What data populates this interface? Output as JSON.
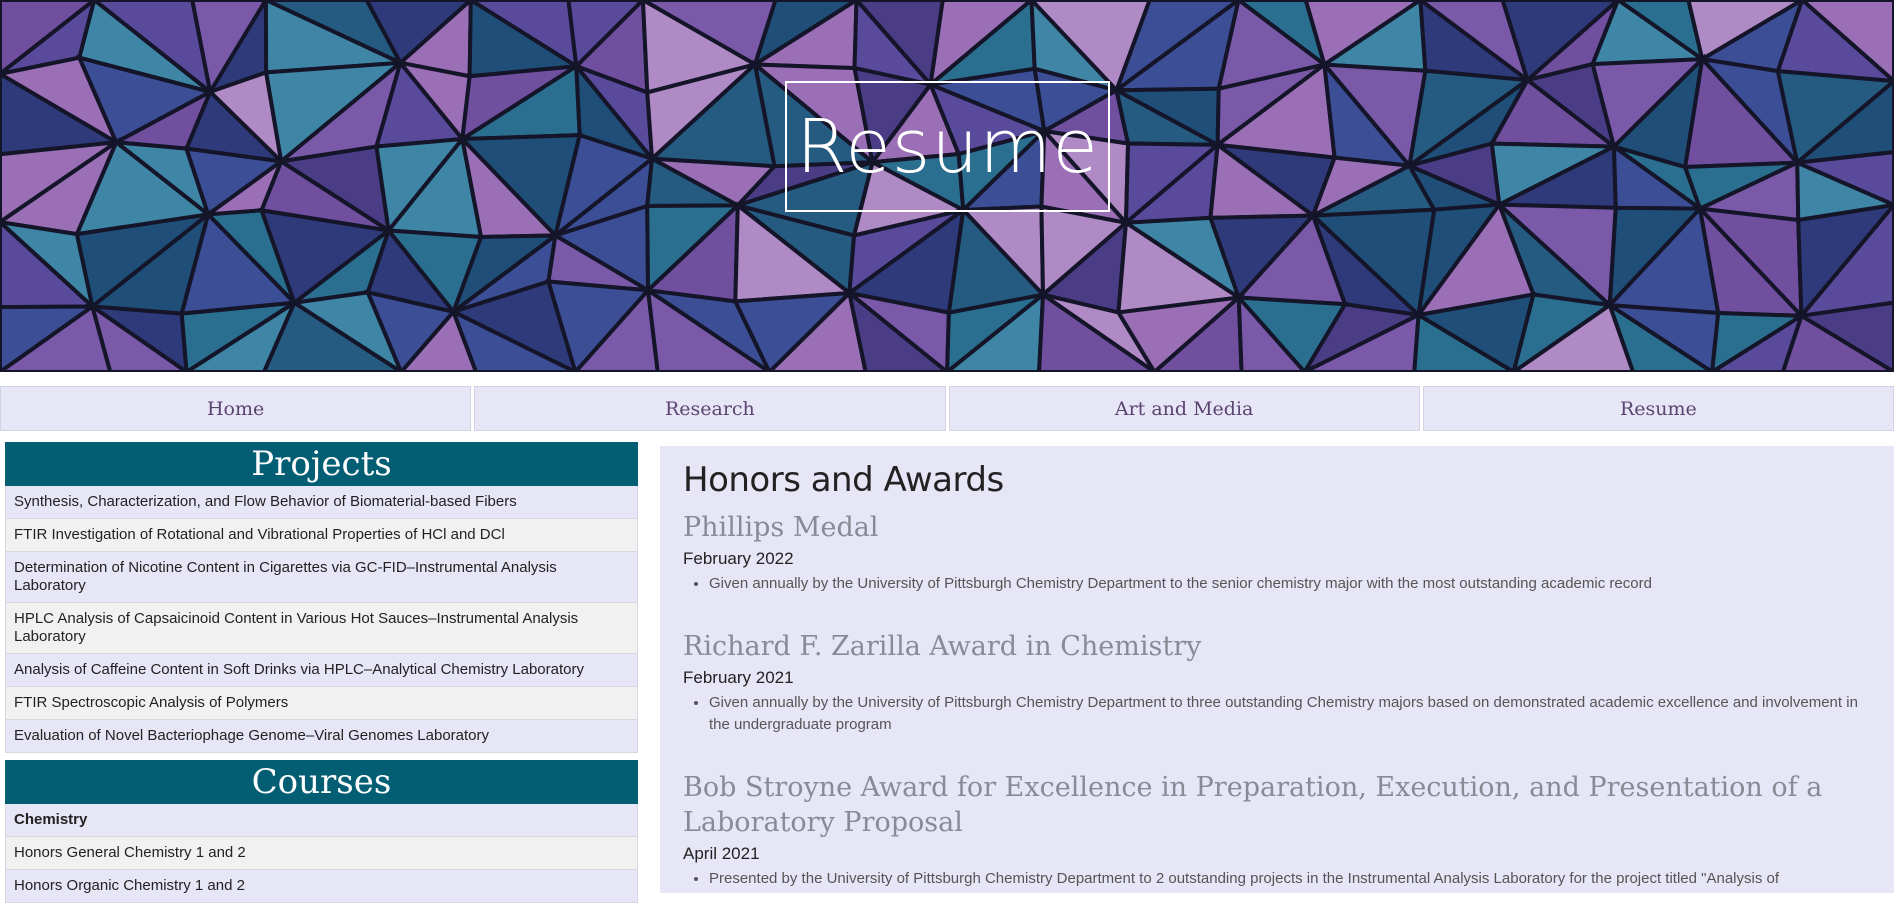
{
  "hero": {
    "title": "Resume"
  },
  "nav": {
    "items": [
      {
        "label": "Home"
      },
      {
        "label": "Research"
      },
      {
        "label": "Art and Media"
      },
      {
        "label": "Resume"
      }
    ]
  },
  "sidebar": {
    "projects": {
      "heading": "Projects",
      "items": [
        "Synthesis, Characterization, and Flow Behavior of Biomaterial-based Fibers",
        "FTIR Investigation of Rotational and Vibrational Properties of HCl and DCl",
        "Determination of Nicotine Content in Cigarettes via GC-FID–Instrumental Analysis Laboratory",
        "HPLC Analysis of Capsaicinoid Content in Various Hot Sauces–Instrumental Analysis Laboratory",
        "Analysis of Caffeine Content in Soft Drinks via HPLC–Analytical Chemistry Laboratory",
        "FTIR Spectroscopic Analysis of Polymers",
        "Evaluation of Novel Bacteriophage Genome–Viral Genomes Laboratory"
      ]
    },
    "courses": {
      "heading": "Courses",
      "subheading": "Chemistry",
      "items": [
        "Honors General Chemistry 1 and 2",
        "Honors Organic Chemistry 1 and 2"
      ]
    }
  },
  "main": {
    "heading": "Honors and Awards",
    "awards": [
      {
        "name": "Phillips Medal",
        "date": "February 2022",
        "desc": "Given annually by the University of Pittsburgh Chemistry Department to the senior chemistry major with the most outstanding academic record"
      },
      {
        "name": "Richard F. Zarilla Award in Chemistry",
        "date": "February 2021",
        "desc": "Given annually by the University of Pittsburgh Chemistry Department to three outstanding Chemistry majors based on demonstrated academic excellence and involvement in the undergraduate program"
      },
      {
        "name": "Bob Stroyne Award for Excellence in Preparation, Execution, and Presentation of a Laboratory Proposal",
        "date": "April 2021",
        "desc": "Presented by the University of Pittsburgh Chemistry Department to 2 outstanding projects in the Instrumental Analysis Laboratory for the project titled \"Analysis of"
      }
    ]
  },
  "colors": {
    "nav_bg": "#e6e6f7",
    "nav_text": "#5b4470",
    "panel_header": "#035e74",
    "main_bg": "#e6e6f7",
    "award_title": "#8a8a95"
  }
}
